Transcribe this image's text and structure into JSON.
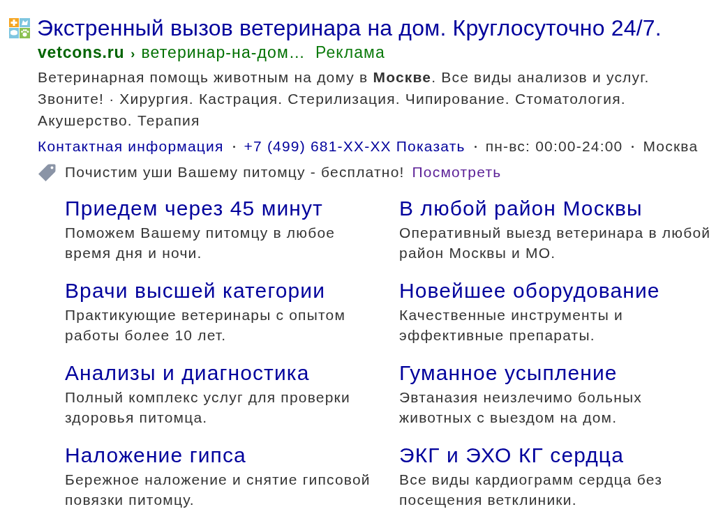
{
  "ad": {
    "title": "Экстренный вызов ветеринара на дом. Круглосуточно 24/7.",
    "domain": "vetcons.ru",
    "path_separator": "›",
    "path": "ветеринар-на-дом…",
    "label": "Реклама",
    "description": "Ветеринарная помощь животным на дому в **Москве**. Все виды анализов и услуг. Звоните! · Хирургия. Кастрация. Стерилизация. Чипирование. Стоматология. Акушерство. Терапия"
  },
  "contacts": [
    {
      "kind": "link",
      "text": "Контактная информация"
    },
    {
      "kind": "phone",
      "text": "+7 (499) 681-XX-XX",
      "action": "Показать"
    },
    {
      "kind": "text",
      "text": "пн-вс: 00:00-24:00"
    },
    {
      "kind": "text",
      "text": "Москва"
    }
  ],
  "promo": {
    "text": "Почистим уши Вашему питомцу - бесплатно!",
    "link": "Посмотреть"
  },
  "sitelinks": [
    {
      "title": "Приедем через 45 минут",
      "description": "Поможем Вашему питомцу в любое время дня и ночи."
    },
    {
      "title": "В любой район Москвы",
      "description": "Оперативный выезд ветеринара в любой район Москвы и МО."
    },
    {
      "title": "Врачи высшей категории",
      "description": "Практикующие ветеринары с опытом работы более 10 лет."
    },
    {
      "title": "Новейшее оборудование",
      "description": "Качественные инструменты и эффективные препараты."
    },
    {
      "title": "Анализы и диагностика",
      "description": "Полный комплекс услуг для проверки здоровья питомца."
    },
    {
      "title": "Гуманное усыпление",
      "description": "Эвтаназия неизлечимо больных животных с выездом на дом."
    },
    {
      "title": "Наложение гипса",
      "description": "Бережное наложение и снятие гипсовой повязки питомцу."
    },
    {
      "title": "ЭКГ и ЭХО КГ сердца",
      "description": "Все виды кардиограмм сердца без посещения ветклиники."
    }
  ]
}
